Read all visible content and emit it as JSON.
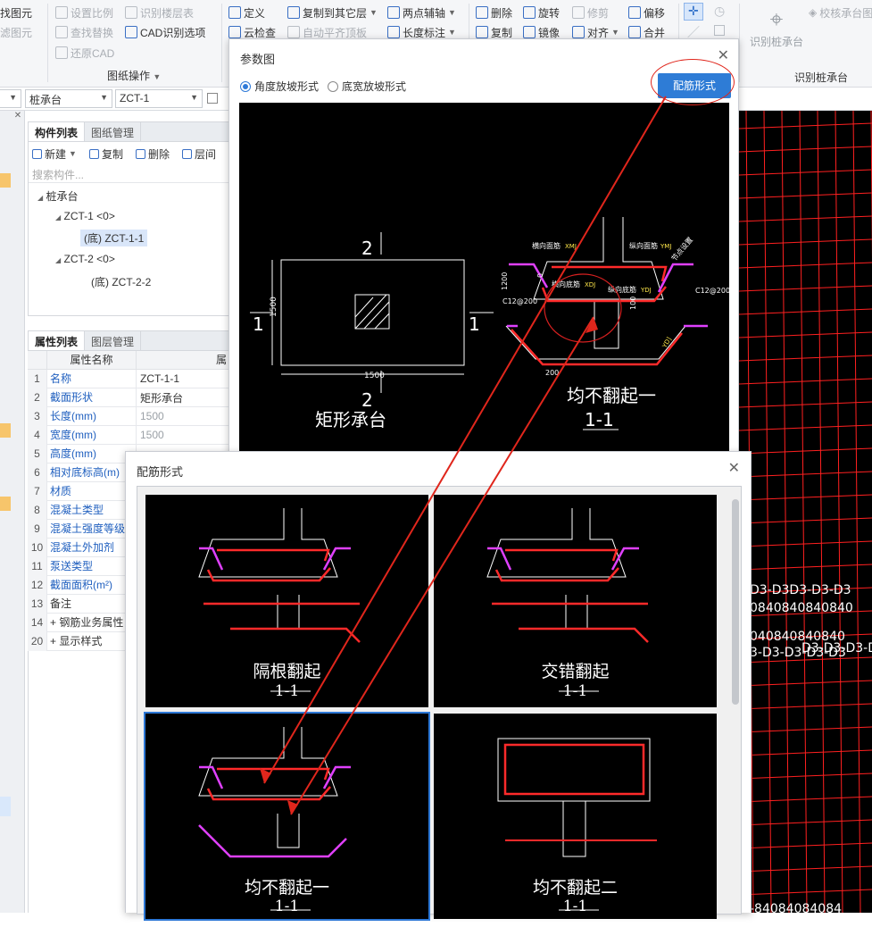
{
  "ribbon": {
    "col1": [
      "找图元",
      "滤图元"
    ],
    "col2": [
      "设置比例",
      "查找替换",
      "还原CAD"
    ],
    "col3": [
      "识别楼层表",
      "CAD识别选项"
    ],
    "group_label": "图纸操作",
    "col4": [
      "定义",
      "云检查"
    ],
    "col5": [
      "复制到其它层",
      "自动平齐顶板"
    ],
    "col6": [
      "两点辅轴",
      "长度标注"
    ],
    "col7": [
      "删除",
      "复制"
    ],
    "col8": [
      "旋转",
      "镜像"
    ],
    "col9": [
      "修剪",
      "对齐"
    ],
    "col10": [
      "偏移",
      "合并"
    ],
    "recognize_label": "识别桩承台",
    "check_label": "校核承台图",
    "recognize_group": "识别桩承台"
  },
  "selbar": {
    "type": "桩承台",
    "name": "ZCT-1"
  },
  "components": {
    "tabs": [
      "构件列表",
      "图纸管理"
    ],
    "toolbar": [
      "新建",
      "复制",
      "删除",
      "层间"
    ],
    "search_placeholder": "搜索构件...",
    "tree": [
      {
        "label": "桩承台",
        "level": 0
      },
      {
        "label": "ZCT-1 <0>",
        "level": 1
      },
      {
        "label": "(底) ZCT-1-1",
        "level": 2,
        "selected": true
      },
      {
        "label": "ZCT-2 <0>",
        "level": 1
      },
      {
        "label": "(底) ZCT-2-2",
        "level": 2
      }
    ]
  },
  "properties": {
    "tabs": [
      "属性列表",
      "图层管理"
    ],
    "header_name": "属性名称",
    "header_value": "属",
    "rows": [
      {
        "n": "1",
        "k": "名称",
        "v": "ZCT-1-1",
        "vdis": false,
        "kblk": false
      },
      {
        "n": "2",
        "k": "截面形状",
        "v": "矩形承台",
        "vdis": false,
        "kblk": false
      },
      {
        "n": "3",
        "k": "长度(mm)",
        "v": "1500",
        "vdis": true,
        "kblk": false
      },
      {
        "n": "4",
        "k": "宽度(mm)",
        "v": "1500",
        "vdis": true,
        "kblk": false
      },
      {
        "n": "5",
        "k": "高度(mm)",
        "v": "",
        "vdis": false,
        "kblk": false
      },
      {
        "n": "6",
        "k": "相对底标高(m)",
        "v": "",
        "vdis": false,
        "kblk": false
      },
      {
        "n": "7",
        "k": "材质",
        "v": "",
        "vdis": false,
        "kblk": false
      },
      {
        "n": "8",
        "k": "混凝土类型",
        "v": "",
        "vdis": false,
        "kblk": false
      },
      {
        "n": "9",
        "k": "混凝土强度等级",
        "v": "",
        "vdis": false,
        "kblk": false
      },
      {
        "n": "10",
        "k": "混凝土外加剂",
        "v": "",
        "vdis": false,
        "kblk": false
      },
      {
        "n": "11",
        "k": "泵送类型",
        "v": "",
        "vdis": false,
        "kblk": false
      },
      {
        "n": "12",
        "k": "截面面积(m²)",
        "v": "",
        "vdis": false,
        "kblk": false
      },
      {
        "n": "13",
        "k": "备注",
        "v": "",
        "vdis": false,
        "kblk": true
      },
      {
        "n": "14",
        "k": "+ 钢筋业务属性",
        "v": "",
        "vdis": false,
        "kblk": true
      },
      {
        "n": "20",
        "k": "+ 显示样式",
        "v": "",
        "vdis": false,
        "kblk": true
      }
    ]
  },
  "param_dialog": {
    "title": "参数图",
    "radio1": "角度放坡形式",
    "radio2": "底宽放坡形式",
    "button": "配筋形式",
    "plan_title": "矩形承台",
    "plan_dim_w": "1500",
    "plan_dim_h": "1500",
    "section_label": "2",
    "side_label": "1",
    "section_title": "均不翻起一",
    "section_sub": "1-1",
    "rebar_labels": {
      "hx": "横向面筋",
      "zx": "纵向面筋",
      "hd": "横向底筋",
      "zd": "纵向底筋",
      "xmj": "XMJ",
      "ymj": "YMJ",
      "xdj": "XDJ",
      "ydj": "YDJ",
      "c12": "C12@200",
      "v1200": "1200",
      "v200": "200",
      "v0": "0",
      "v100": "100",
      "jd": "节点设置",
      "ydj2": "YD]"
    }
  },
  "rebar_dialog": {
    "title": "配筋形式",
    "options": [
      {
        "title": "隔根翻起",
        "sub": "1-1"
      },
      {
        "title": "交错翻起",
        "sub": "1-1"
      },
      {
        "title": "均不翻起一",
        "sub": "1-1"
      },
      {
        "title": "均不翻起二",
        "sub": "1-1"
      }
    ]
  },
  "cad_right_text": [
    "D3-D3D3-D3-D3",
    "0840840840840",
    "040840840840",
    "3-D3-D3-D3-D3",
    "D3-D3-D3-D3"
  ],
  "cad_bottom_text": "-84084084084"
}
